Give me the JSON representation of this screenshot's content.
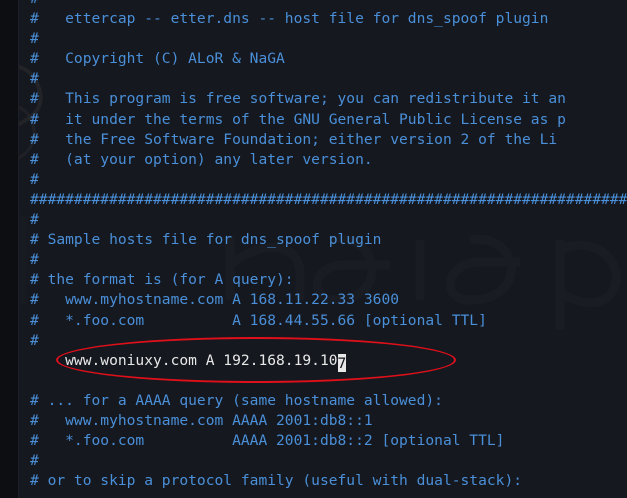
{
  "editor": {
    "file_lines": [
      {
        "text": "#",
        "style": "comment"
      },
      {
        "text": "#   ettercap -- etter.dns -- host file for dns_spoof plugin",
        "style": "comment"
      },
      {
        "text": "#",
        "style": "comment"
      },
      {
        "text": "#   Copyright (C) ALoR & NaGA",
        "style": "comment"
      },
      {
        "text": "#",
        "style": "comment"
      },
      {
        "text": "#   This program is free software; you can redistribute it an",
        "style": "comment"
      },
      {
        "text": "#   it under the terms of the GNU General Public License as p",
        "style": "comment"
      },
      {
        "text": "#   the Free Software Foundation; either version 2 of the Li",
        "style": "comment"
      },
      {
        "text": "#   (at your option) any later version.",
        "style": "comment"
      },
      {
        "text": "#",
        "style": "comment"
      },
      {
        "text": "####################################################################",
        "style": "comment"
      },
      {
        "text": "#",
        "style": "comment"
      },
      {
        "text": "# Sample hosts file for dns_spoof plugin",
        "style": "comment"
      },
      {
        "text": "#",
        "style": "comment"
      },
      {
        "text": "# the format is (for A query):",
        "style": "comment"
      },
      {
        "text": "#   www.myhostname.com A 168.11.22.33 3600",
        "style": "comment"
      },
      {
        "text": "#   *.foo.com          A 168.44.55.66 [optional TTL]",
        "style": "comment"
      },
      {
        "text": "#",
        "style": "comment"
      },
      {
        "text": "    www.woniuxy.com A 192.168.19.10",
        "style": "plain",
        "cursor_char": "7"
      },
      {
        "text": "",
        "style": "plain"
      },
      {
        "text": "# ... for a AAAA query (same hostname allowed):",
        "style": "comment"
      },
      {
        "text": "#   www.myhostname.com AAAA 2001:db8::1",
        "style": "comment"
      },
      {
        "text": "#   *.foo.com          AAAA 2001:db8::2 [optional TTL]",
        "style": "comment"
      },
      {
        "text": "#",
        "style": "comment"
      },
      {
        "text": "# or to skip a protocol family (useful with dual-stack):",
        "style": "comment"
      }
    ]
  },
  "colors": {
    "comment": "#4a8fd8",
    "plain_text": "#e8e8e8",
    "annotation_ellipse": "#e0101a",
    "background": "#14161d"
  }
}
